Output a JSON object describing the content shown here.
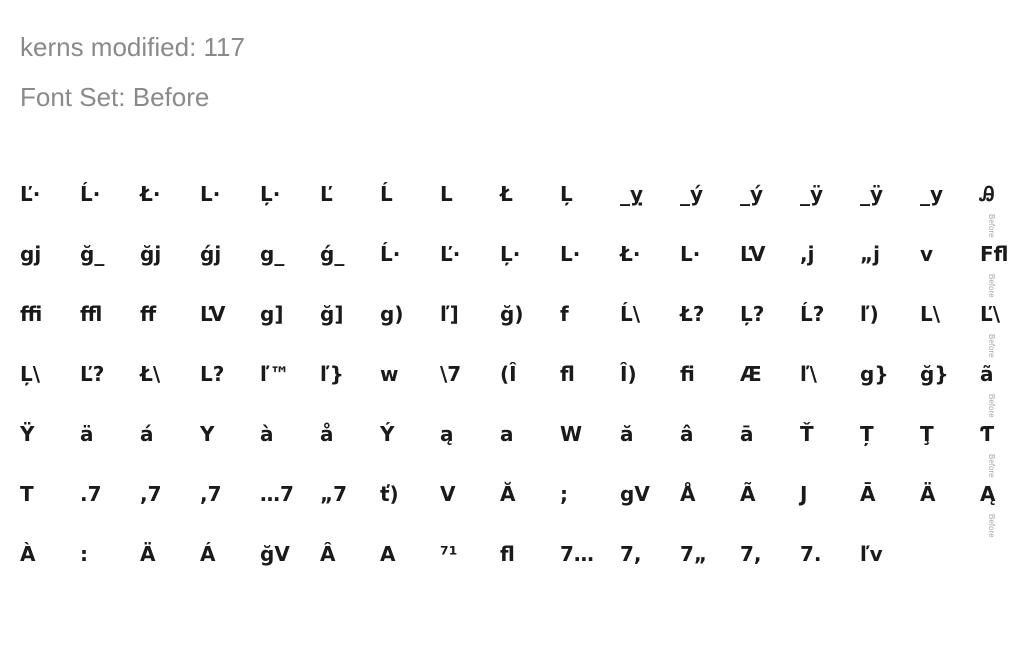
{
  "header": {
    "kerns_modified": "kerns modified: 117",
    "font_set": "Font Set: Before"
  },
  "row_tag": "Before",
  "rows": [
    [
      "Ľ·",
      "Ĺ·",
      "Ł·",
      "L·",
      "Ļ·",
      "Ľ",
      "Ĺ",
      "L",
      "Ł",
      "Ļ",
      "_ỵ",
      "_ý",
      "_ý",
      "_ÿ",
      "_ÿ",
      "_y",
      "Ꭿ"
    ],
    [
      "gj",
      "ğ_",
      "ğj",
      "ǵj",
      "g_",
      "ǵ_",
      "Ĺ·",
      "Ľ·",
      "Ļ·",
      "L·",
      "Ł·",
      "L·",
      "ĽV",
      ",j",
      "„j",
      "v",
      "Ffl"
    ],
    [
      "ffi",
      "ffl",
      "ff",
      "ĽV",
      "g]",
      "ğ]",
      "g)",
      "ľ]",
      "ğ)",
      "f",
      "Ĺ\\",
      "Ł?",
      "Ļ?",
      "Ĺ?",
      "ľ)",
      "L\\",
      "Ľ\\"
    ],
    [
      "Ļ\\",
      "Ľ?",
      "Ł\\",
      "L?",
      "ľ™",
      "ľ}",
      "w",
      "\\7",
      "(Î",
      "fl",
      "Î)",
      "fi",
      "Æ",
      "ľ\\",
      "g}",
      "ğ}",
      "ã"
    ],
    [
      "Ÿ",
      "ä",
      "á",
      "Y",
      "à",
      "å",
      "Ý",
      "ą",
      "a",
      "W",
      "ă",
      "â",
      "ā",
      "Ť",
      "Ț",
      "Ţ",
      "Ƭ"
    ],
    [
      "T",
      ".7",
      ",7",
      ",7",
      "…7",
      "„7",
      "ť)",
      "V",
      "Ă",
      ";",
      "gV",
      "Å",
      "Ã",
      "J",
      "Ā",
      "Ä",
      "Ą"
    ],
    [
      "À",
      ":",
      "Ä",
      "Á",
      "ğV",
      "Â",
      "A",
      "⁷¹",
      "fl",
      "7…",
      "7,",
      "7„",
      "7,",
      "7.",
      "ľv"
    ]
  ]
}
